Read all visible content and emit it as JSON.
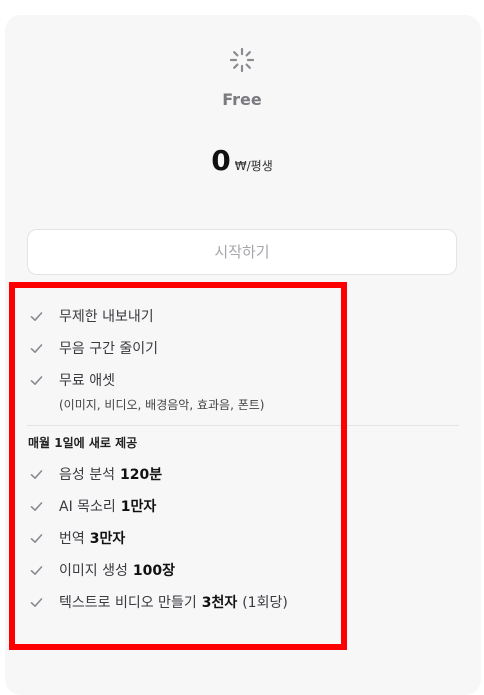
{
  "plan": {
    "name": "Free",
    "price_amount": "0",
    "price_currency": "₩",
    "price_period": "/평생",
    "cta_label": "시작하기"
  },
  "features": [
    {
      "text": "무제한 내보내기",
      "value": "",
      "suffix": ""
    },
    {
      "text": "무음 구간 줄이기",
      "value": "",
      "suffix": ""
    },
    {
      "text": "무료 애셋",
      "value": "",
      "suffix": ""
    }
  ],
  "assets_note": "(이미지, 비디오, 배경음악, 효과음, 폰트)",
  "monthly_section": {
    "title": "매월 1일에 새로 제공",
    "items": [
      {
        "text": "음성 분석",
        "value": "120분",
        "suffix": ""
      },
      {
        "text": "AI 목소리",
        "value": "1만자",
        "suffix": ""
      },
      {
        "text": "번역",
        "value": "3만자",
        "suffix": ""
      },
      {
        "text": "이미지 생성",
        "value": "100장",
        "suffix": ""
      },
      {
        "text": "텍스트로 비디오 만들기",
        "value": "3천자",
        "suffix": "(1회당)"
      }
    ]
  },
  "icons": {
    "plan_icon": "loader-icon",
    "feature_icon": "check-icon"
  },
  "colors": {
    "card_background": "#f7f7f8",
    "highlight_border": "#ff0000",
    "check_icon": "#8a8a90",
    "muted_text": "#a7a7ad"
  }
}
